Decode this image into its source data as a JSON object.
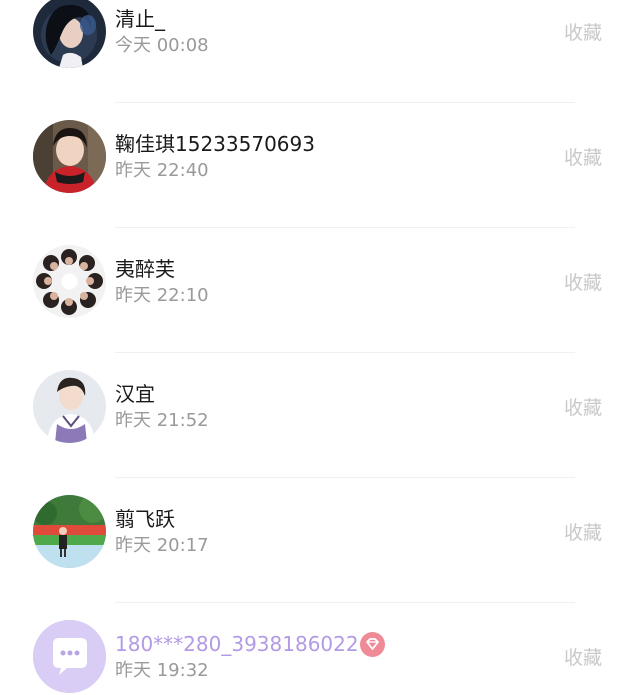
{
  "items": [
    {
      "name": "清止_",
      "time": "今天 00:08",
      "action": "收藏",
      "avatar": "portrait-woman-dark-hair"
    },
    {
      "name": "鞠佳琪15233570693",
      "time": "昨天 22:40",
      "action": "收藏",
      "avatar": "portrait-girl-red-scarf"
    },
    {
      "name": "夷醉芙",
      "time": "昨天 22:10",
      "action": "收藏",
      "avatar": "group-of-faces-circle"
    },
    {
      "name": "汉宜",
      "time": "昨天 21:52",
      "action": "收藏",
      "avatar": "portrait-boy-purple-vest"
    },
    {
      "name": "翦飞跃",
      "time": "昨天 20:17",
      "action": "收藏",
      "avatar": "child-in-park"
    },
    {
      "name": "180***280_3938186022",
      "time": "昨天 19:32",
      "action": "收藏",
      "avatar": "default-chat-avatar",
      "vip": true
    }
  ],
  "colors": {
    "vip_name": "#b39ae6",
    "vip_badge": "#ef8b97",
    "default_avatar_bg": "#d9ccf5"
  },
  "icons": {
    "vip_badge": "diamond-icon"
  }
}
